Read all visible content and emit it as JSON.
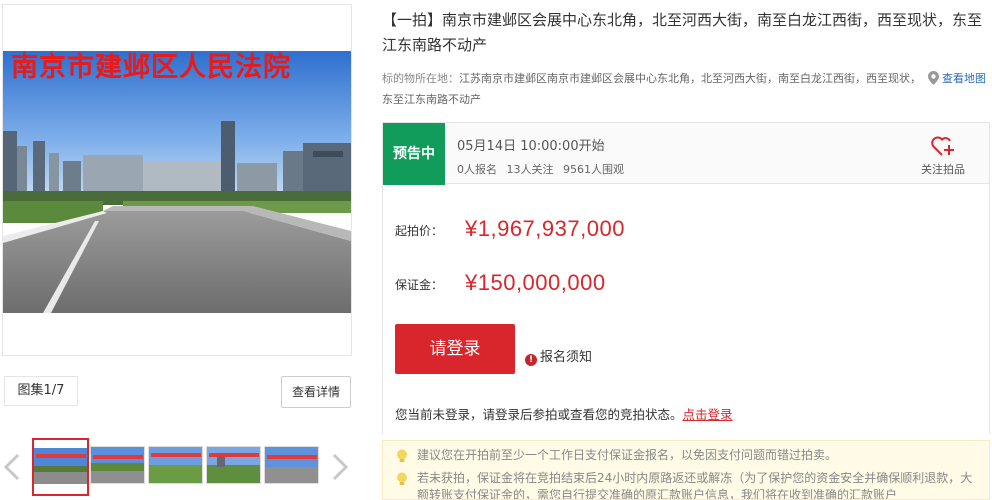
{
  "gallery": {
    "overlay_text": "南京市建邺区人民法院",
    "count_label": "图集1/7",
    "detail_button": "查看详情"
  },
  "listing": {
    "title": "【一拍】南京市建邺区会展中心东北角，北至河西大街，南至白龙江西街，西至现状，东至江东南路不动产",
    "location_label": "标的物所在地：",
    "location_text": "江苏南京市建邺区南京市建邺区会展中心东北角，北至河西大街，南至白龙江西街，西至现状，东至江东南路不动产",
    "map_link": "查看地图"
  },
  "status": {
    "badge": "预告中",
    "start_time": "05月14日 10:00:00开始",
    "registered": "0人报名",
    "followers": "13人关注",
    "views": "9561人围观",
    "follow_label": "关注拍品"
  },
  "price": {
    "start_label": "起拍价：",
    "start_value": "¥1,967,937,000",
    "deposit_label": "保证金：",
    "deposit_value": "¥150,000,000"
  },
  "actions": {
    "login_button": "请登录",
    "notice_link": "报名须知",
    "login_hint": "您当前未登录，请登录后参拍或查看您的竞拍状态。",
    "login_link": "点击登录"
  },
  "tips": [
    "建议您在开拍前至少一个工作日支付保证金报名，以免因支付问题而错过拍卖。",
    "若未获拍，保证金将在竞拍结束后24小时内原路返还或解冻（为了保护您的资金安全并确保顺利退款，大额转账支付保证金的，需您自行提交准确的原汇款账户信息，我们将在收到准确的汇款账户"
  ],
  "colors": {
    "accent": "#d9262c",
    "status_green": "#129c5c",
    "link_blue": "#2b6cb5"
  }
}
